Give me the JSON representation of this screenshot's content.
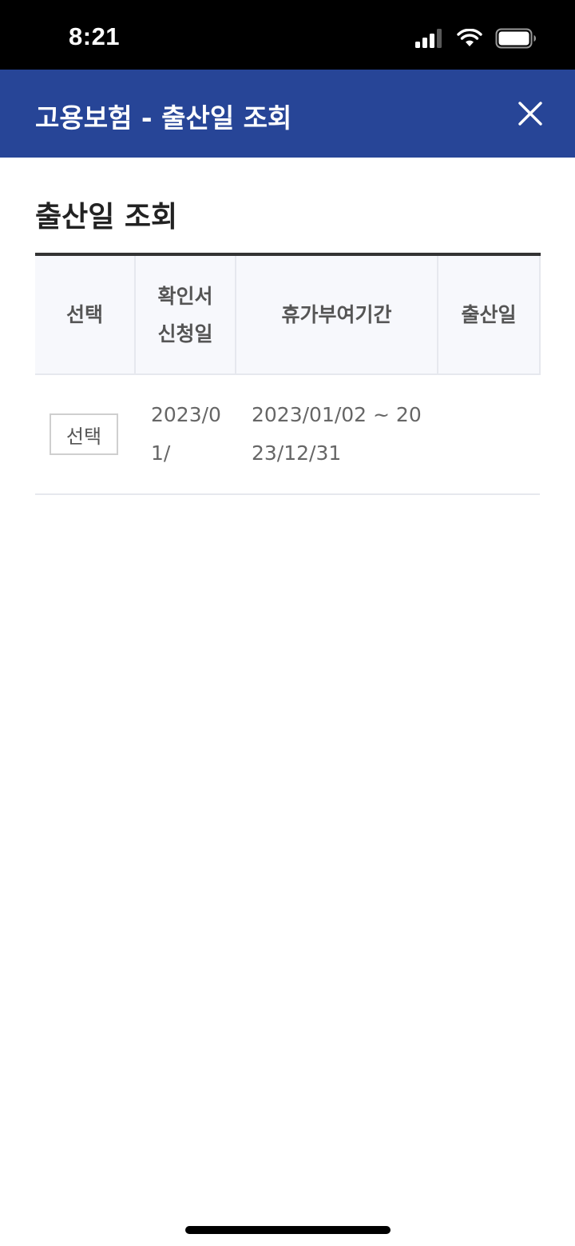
{
  "status_bar": {
    "time": "8:21",
    "icons": [
      "signal-icon",
      "wifi-icon",
      "battery-icon"
    ]
  },
  "header": {
    "title": "고용보험 - 출산일 조회",
    "close_icon": "close-icon",
    "background": "#274597"
  },
  "section": {
    "title": "출산일 조회"
  },
  "table": {
    "columns": [
      "선택",
      "확인서\n신청일",
      "휴가부여기간",
      "출산일"
    ],
    "rows": [
      {
        "select_label": "선택",
        "application_date": "2023/01/",
        "leave_period": "2023/01/02 ~ 2023/12/31",
        "birth_date": ""
      }
    ]
  }
}
